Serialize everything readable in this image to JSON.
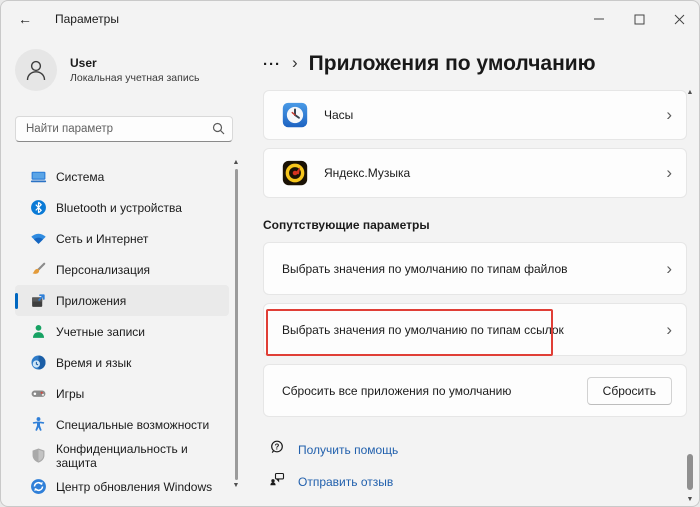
{
  "window": {
    "title": "Параметры"
  },
  "icons": {
    "back": "←",
    "chevron": "›",
    "scroll_up": "▲",
    "scroll_down": "▼"
  },
  "sidebar": {
    "user": {
      "name": "User",
      "subtitle": "Локальная учетная запись"
    },
    "search": {
      "placeholder": "Найти параметр"
    },
    "items": [
      {
        "label": "Система",
        "icon": "system-icon"
      },
      {
        "label": "Bluetooth и устройства",
        "icon": "bluetooth-icon"
      },
      {
        "label": "Сеть и Интернет",
        "icon": "network-icon"
      },
      {
        "label": "Персонализация",
        "icon": "personalization-icon"
      },
      {
        "label": "Приложения",
        "icon": "apps-icon",
        "selected": true
      },
      {
        "label": "Учетные записи",
        "icon": "accounts-icon"
      },
      {
        "label": "Время и язык",
        "icon": "time-language-icon"
      },
      {
        "label": "Игры",
        "icon": "gaming-icon"
      },
      {
        "label": "Специальные возможности",
        "icon": "accessibility-icon"
      },
      {
        "label": "Конфиденциальность и защита",
        "icon": "privacy-icon"
      },
      {
        "label": "Центр обновления Windows",
        "icon": "windows-update-icon"
      }
    ]
  },
  "main": {
    "breadcrumb": {
      "ellipsis": "···",
      "title": "Приложения по умолчанию"
    },
    "apps": [
      {
        "name": "Часы",
        "icon": "clock-app-icon"
      },
      {
        "name": "Яндекс.Музыка",
        "icon": "yandex-music-icon"
      }
    ],
    "related_header": "Сопутствующие параметры",
    "related": [
      {
        "label": "Выбрать значения по умолчанию по типам файлов"
      },
      {
        "label": "Выбрать значения по умолчанию по типам ссылок",
        "highlighted": true
      }
    ],
    "reset": {
      "label": "Сбросить все приложения по умолчанию",
      "button": "Сбросить"
    },
    "links": [
      {
        "label": "Получить помощь",
        "icon": "get-help-icon"
      },
      {
        "label": "Отправить отзыв",
        "icon": "send-feedback-icon"
      }
    ]
  },
  "colors": {
    "accent": "#0067c0",
    "link": "#2160ad",
    "highlight_border": "#e03e36"
  }
}
